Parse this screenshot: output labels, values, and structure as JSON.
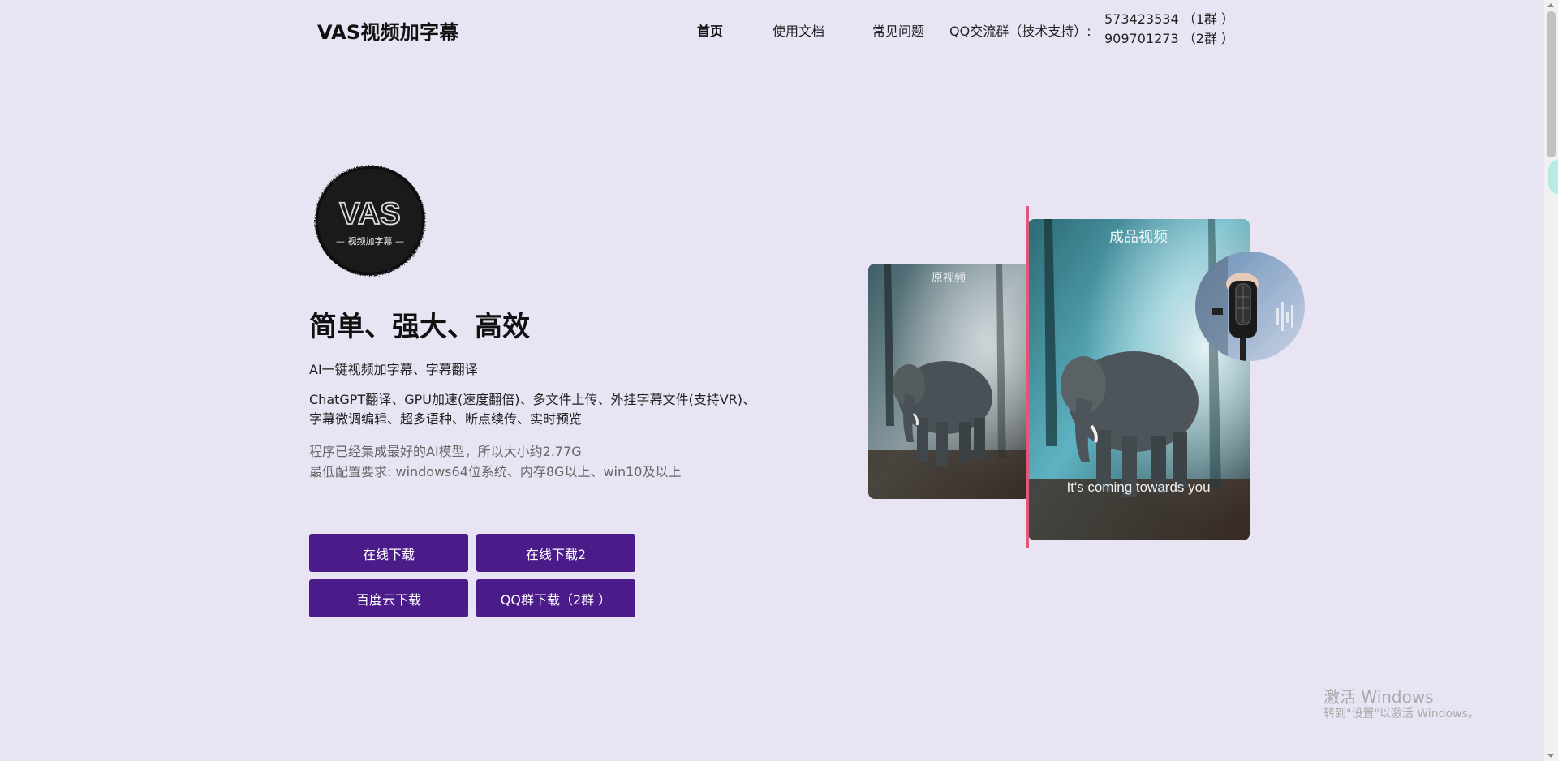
{
  "header": {
    "brand": "VAS视频加字幕",
    "nav": {
      "home": "首页",
      "docs": "使用文档",
      "faq": "常见问题"
    },
    "qq_label": "QQ交流群（技术支持）:",
    "qq_group1": "573423534 （1群 ）",
    "qq_group2": "909701273 （2群 ）"
  },
  "logo": {
    "text": "VAS",
    "subtext": "— 视频加字幕 —",
    "icon": "vas-logo-icon"
  },
  "hero": {
    "title": "简单、强大、高效",
    "subtitle": "AI一键视频加字幕、字幕翻译",
    "features_line1": "ChatGPT翻译、GPU加速(速度翻倍)、多文件上传、外挂字幕文件(支持VR)、",
    "features_line2": "字幕微调编辑、超多语种、断点续传、实时预览",
    "note_line1": "程序已经集成最好的AI模型，所以大小约2.77G",
    "note_line2": "最低配置要求: windows64位系统、内存8G以上、win10及以上"
  },
  "buttons": {
    "online1": "在线下载",
    "online2": "在线下载2",
    "baidu": "百度云下载",
    "qq": "QQ群下载（2群 ）"
  },
  "illustration": {
    "original_label": "原视频",
    "result_label": "成品视频",
    "subtitle_sample": "It's coming towards you"
  },
  "watermark": {
    "title": "激活 Windows",
    "subtitle": "转到\"设置\"以激活 Windows。"
  },
  "colors": {
    "background": "#e9e4f4",
    "button": "#4b1b8a",
    "divider": "#e0577a"
  }
}
